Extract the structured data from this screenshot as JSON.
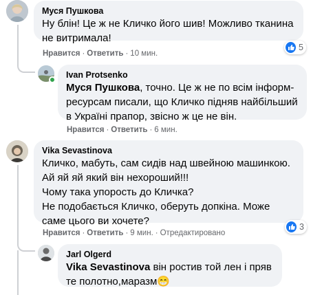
{
  "colors": {
    "bubble": "#f0f2f5",
    "meta": "#65676b",
    "like": "#1877f2",
    "online": "#31a24c"
  },
  "comments": [
    {
      "author": "Муся Пушкова",
      "text": "Ну блін! Це ж не Кличко його шив! Можливо тканина не витримала!",
      "like_label": "Нравится",
      "reply_label": "Ответить",
      "time": "10 мин.",
      "reaction_count": "5",
      "reaction_icon": "like-icon"
    },
    {
      "author": "Ivan Protsenko",
      "mention": "Муся Пушкова",
      "text": ", точно. Це ж не по всім інформ-ресурсам писали, що Кличко підняв найбільший в Україні прапор, звісно ж це не він.",
      "like_label": "Нравится",
      "reply_label": "Ответить",
      "time": "6 мин."
    },
    {
      "author": "Vika Sevastinova",
      "text": "Кличко, мабуть, сам сидів над швейною машинкою.\nАй яй яй який він нехороший!!!\nЧому така упорость до Кличка?\nНе подобається Кличко, оберуть допкіна. Може саме цього ви хочете?",
      "like_label": "Нравится",
      "reply_label": "Ответить",
      "time": "9 мин.",
      "edited": "Отредактировано",
      "reaction_count": "3",
      "reaction_icon": "like-icon"
    },
    {
      "author": "Jarl Olgerd",
      "mention": "Vika Sevastinova",
      "text": " він ростив той лен і пряв те полотно,маразм",
      "emoji": "😁"
    }
  ]
}
